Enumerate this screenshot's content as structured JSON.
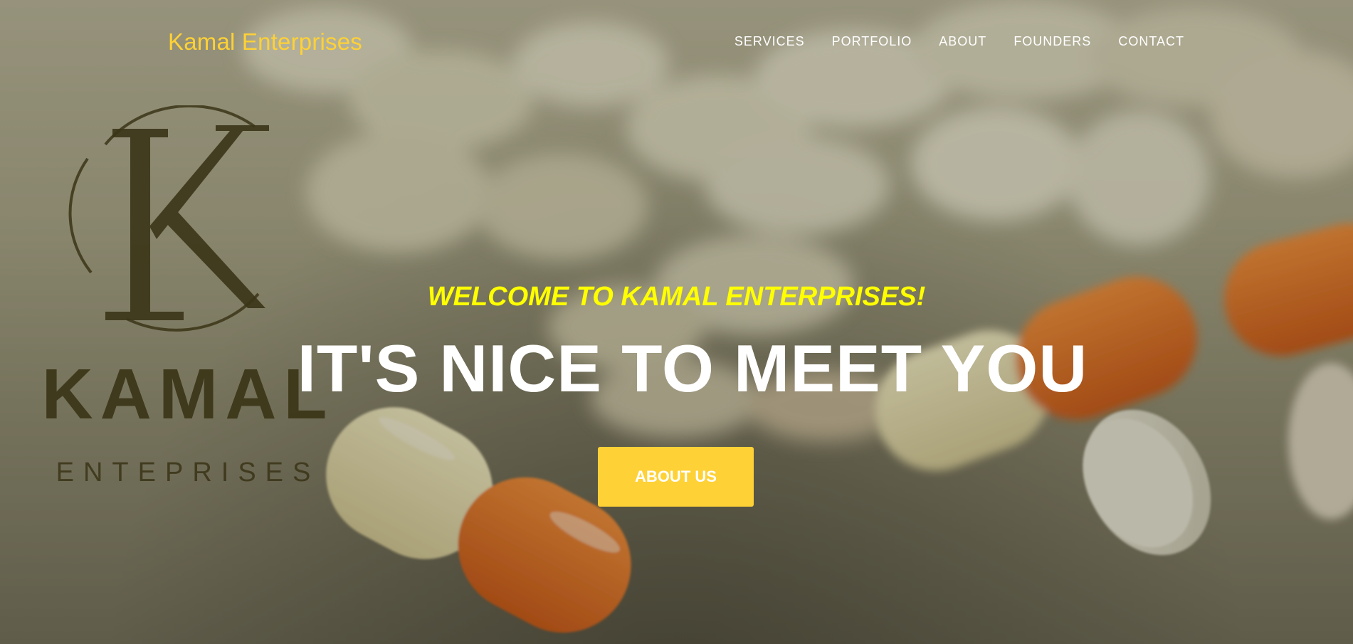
{
  "navbar": {
    "brand": "Kamal Enterprises",
    "links": [
      {
        "label": "SERVICES"
      },
      {
        "label": "PORTFOLIO"
      },
      {
        "label": "ABOUT"
      },
      {
        "label": "FOUNDERS"
      },
      {
        "label": "CONTACT"
      }
    ]
  },
  "logo": {
    "wordmark": "KAMAL",
    "tagline": "ENTEPRISES",
    "monogram": "K"
  },
  "hero": {
    "lead_in": "WELCOME TO KAMAL ENTERPRISES!",
    "heading": "IT'S NICE TO MEET YOU",
    "cta_label": "ABOUT US",
    "background_image": "pills-and-capsules-photo"
  },
  "colors": {
    "accent": "#fed136",
    "lead_in": "#ffff00",
    "heading": "#ffffff",
    "logo": "#3b3518",
    "capsule_orange": "#e8641a",
    "capsule_cream": "#efe6b8",
    "tablet": "#e6e3cf"
  }
}
